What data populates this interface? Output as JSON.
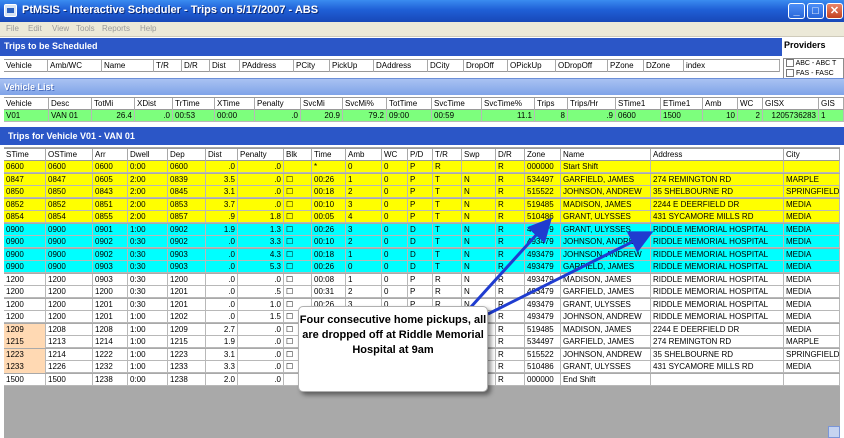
{
  "window": {
    "title": "PtMSIS - Interactive Scheduler - Trips on 5/17/2007 - ABS",
    "minimize": "_",
    "maximize": "□",
    "close": "✕"
  },
  "menu": [
    "File",
    "Edit",
    "View",
    "Tools",
    "Reports",
    "Help"
  ],
  "to_schedule": {
    "title": "Trips to be Scheduled",
    "columns": [
      "Vehicle",
      "Amb/WC",
      "Name",
      "T/R",
      "D/R",
      "Dist",
      "PAddress",
      "PCity",
      "PickUp",
      "DAddress",
      "DCity",
      "DropOff",
      "OPickUp",
      "ODropOff",
      "PZone",
      "DZone",
      "index"
    ]
  },
  "providers": {
    "title": "Providers",
    "items": [
      "ABC - ABC T",
      "FAS - FASC"
    ]
  },
  "vehicle_list": {
    "title": "Vehicle List",
    "columns": [
      "Vehicle",
      "Desc",
      "TotMi",
      "XDist",
      "TrTime",
      "XTime",
      "Penalty",
      "SvcMi",
      "SvcMi%",
      "TotTime",
      "SvcTime",
      "SvcTime%",
      "Trips",
      "Trips/Hr",
      "STime1",
      "ETime1",
      "Amb",
      "WC",
      "GISX",
      "GIS"
    ],
    "row": [
      "V01",
      "VAN 01",
      "26.4",
      ".0",
      "00:53",
      "00:00",
      ".0",
      "20.9",
      "79.2",
      "09:00",
      "00:59",
      "11.1",
      "8",
      ".9",
      "0600",
      "1500",
      "10",
      "2",
      "1205736283",
      "1"
    ]
  },
  "trips": {
    "title": "Trips for Vehicle V01 - VAN 01",
    "columns": [
      "STime",
      "OSTime",
      "Arr",
      "Dwell",
      "Dep",
      "Dist",
      "Penalty",
      "Blk",
      "Time",
      "Amb",
      "WC",
      "P/D",
      "T/R",
      "Swp",
      "D/R",
      "Zone",
      "Name",
      "Address",
      "City"
    ],
    "rows": [
      {
        "c": [
          "0600",
          "0600",
          "0600",
          "0:00",
          "0600",
          ".0",
          ".0",
          "",
          "*",
          "0",
          "0",
          "P",
          "R",
          "",
          "R",
          "000000",
          "Start Shift",
          "",
          ""
        ],
        "bg": "yellow"
      },
      {
        "c": [
          "0847",
          "0847",
          "0605",
          "2:00",
          "0839",
          "3.5",
          ".0",
          "☐",
          "00:26",
          "1",
          "0",
          "P",
          "T",
          "N",
          "R",
          "534497",
          "GARFIELD, JAMES",
          "274 REMINGTON RD",
          "MARPLE"
        ],
        "bg": "yellow"
      },
      {
        "c": [
          "0850",
          "0850",
          "0843",
          "2:00",
          "0845",
          "3.1",
          ".0",
          "☐",
          "00:18",
          "2",
          "0",
          "P",
          "T",
          "N",
          "R",
          "515522",
          "JOHNSON, ANDREW",
          "35 SHELBOURNE RD",
          "SPRINGFIELD"
        ],
        "bg": "yellow"
      },
      {
        "c": [
          "0852",
          "0852",
          "0851",
          "2:00",
          "0853",
          "3.7",
          ".0",
          "☐",
          "00:10",
          "3",
          "0",
          "P",
          "T",
          "N",
          "R",
          "519485",
          "MADISON, JAMES",
          "2244 E DEERFIELD DR",
          "MEDIA"
        ],
        "bg": "yellow"
      },
      {
        "c": [
          "0854",
          "0854",
          "0855",
          "2:00",
          "0857",
          ".9",
          "1.8",
          "☐",
          "00:05",
          "4",
          "0",
          "P",
          "T",
          "N",
          "R",
          "510486",
          "GRANT, ULYSSES",
          "431 SYCAMORE MILLS RD",
          "MEDIA"
        ],
        "bg": "yellow"
      },
      {
        "c": [
          "0900",
          "0900",
          "0901",
          "1:00",
          "0902",
          "1.9",
          "1.3",
          "☐",
          "00:26",
          "3",
          "0",
          "D",
          "T",
          "N",
          "R",
          "493479",
          "GRANT, ULYSSES",
          "RIDDLE MEMORIAL HOSPITAL",
          "MEDIA"
        ],
        "bg": "cyan"
      },
      {
        "c": [
          "0900",
          "0900",
          "0902",
          "0:30",
          "0902",
          ".0",
          "3.3",
          "☐",
          "00:10",
          "2",
          "0",
          "D",
          "T",
          "N",
          "R",
          "493479",
          "JOHNSON, ANDREW",
          "RIDDLE MEMORIAL HOSPITAL",
          "MEDIA"
        ],
        "bg": "cyan"
      },
      {
        "c": [
          "0900",
          "0900",
          "0902",
          "0:30",
          "0903",
          ".0",
          "4.3",
          "☐",
          "00:18",
          "1",
          "0",
          "D",
          "T",
          "N",
          "R",
          "493479",
          "JOHNSON, ANDREW",
          "RIDDLE MEMORIAL HOSPITAL",
          "MEDIA"
        ],
        "bg": "cyan"
      },
      {
        "c": [
          "0900",
          "0900",
          "0903",
          "0:30",
          "0903",
          ".0",
          "5.3",
          "☐",
          "00:26",
          "0",
          "0",
          "D",
          "T",
          "N",
          "R",
          "493479",
          "GARFIELD, JAMES",
          "RIDDLE MEMORIAL HOSPITAL",
          "MEDIA"
        ],
        "bg": "cyan"
      },
      {
        "c": [
          "1200",
          "1200",
          "0903",
          "0:30",
          "1200",
          ".0",
          ".0",
          "☐",
          "00:08",
          "1",
          "0",
          "P",
          "R",
          "N",
          "R",
          "493479",
          "MADISON, JAMES",
          "RIDDLE MEMORIAL HOSPITAL",
          "MEDIA"
        ],
        "bg": "white"
      },
      {
        "c": [
          "1200",
          "1200",
          "1200",
          "0:30",
          "1201",
          ".0",
          ".5",
          "☐",
          "00:31",
          "2",
          "0",
          "P",
          "R",
          "N",
          "R",
          "493479",
          "GARFIELD, JAMES",
          "RIDDLE MEMORIAL HOSPITAL",
          "MEDIA"
        ],
        "bg": "white"
      },
      {
        "c": [
          "1200",
          "1200",
          "1201",
          "0:30",
          "1201",
          ".0",
          "1.0",
          "☐",
          "00:26",
          "3",
          "0",
          "P",
          "R",
          "N",
          "R",
          "493479",
          "GRANT, ULYSSES",
          "RIDDLE MEMORIAL HOSPITAL",
          "MEDIA"
        ],
        "bg": "white"
      },
      {
        "c": [
          "1200",
          "1200",
          "1201",
          "1:00",
          "1202",
          ".0",
          "1.5",
          "☐",
          "00:26",
          "3",
          "0",
          "P",
          "R",
          "N",
          "R",
          "493479",
          "JOHNSON, ANDREW",
          "RIDDLE MEMORIAL HOSPITAL",
          "MEDIA"
        ],
        "bg": "white"
      },
      {
        "c": [
          "1209",
          "1208",
          "1208",
          "1:00",
          "1209",
          "2.7",
          ".0",
          "☐",
          "",
          "0",
          "0",
          "D",
          "R",
          "N",
          "R",
          "519485",
          "MADISON, JAMES",
          "2244 E DEERFIELD DR",
          "MEDIA"
        ],
        "bg": "white",
        "stime_bg": "peach"
      },
      {
        "c": [
          "1215",
          "1213",
          "1214",
          "1:00",
          "1215",
          "1.9",
          ".0",
          "☐",
          "",
          "0",
          "0",
          "D",
          "R",
          "N",
          "R",
          "534497",
          "GARFIELD, JAMES",
          "274 REMINGTON RD",
          "MARPLE"
        ],
        "bg": "white",
        "stime_bg": "peach"
      },
      {
        "c": [
          "1223",
          "1214",
          "1222",
          "1:00",
          "1223",
          "3.1",
          ".0",
          "☐",
          "",
          "0",
          "0",
          "D",
          "R",
          "N",
          "R",
          "515522",
          "JOHNSON, ANDREW",
          "35 SHELBOURNE RD",
          "SPRINGFIELD"
        ],
        "bg": "white",
        "stime_bg": "peach"
      },
      {
        "c": [
          "1233",
          "1226",
          "1232",
          "1:00",
          "1233",
          "3.3",
          ".0",
          "☐",
          "",
          "0",
          "0",
          "D",
          "R",
          "N",
          "R",
          "510486",
          "GRANT, ULYSSES",
          "431 SYCAMORE MILLS RD",
          "MEDIA"
        ],
        "bg": "white",
        "stime_bg": "peach"
      },
      {
        "c": [
          "1500",
          "1500",
          "1238",
          "0:00",
          "1238",
          "2.0",
          ".0",
          "",
          "",
          "0",
          "0",
          "D",
          "R",
          "",
          "R",
          "000000",
          "End Shift",
          "",
          ""
        ],
        "bg": "white"
      }
    ]
  },
  "callout": {
    "text": "Four consecutive home pickups, all are dropped off at Riddle Memorial Hospital at 9am"
  },
  "colors": {
    "yellow": "#ffff00",
    "cyan": "#00ffff",
    "white": "#ffffff",
    "peach": "#ffd9b3",
    "green": "#7dff7d",
    "arrow": "#1f3cd0"
  }
}
